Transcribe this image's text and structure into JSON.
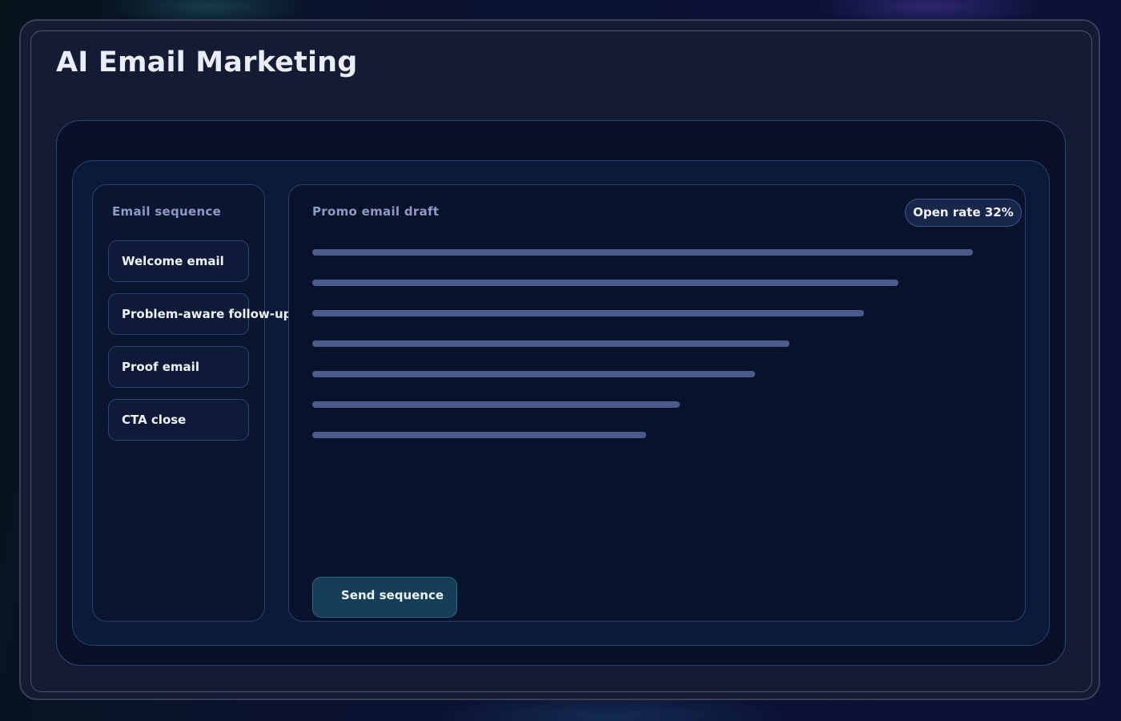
{
  "header": {
    "title": "AI Email Marketing"
  },
  "sidebar": {
    "heading": "Email sequence",
    "items": [
      {
        "label": "Welcome email"
      },
      {
        "label": "Problem-aware follow-up"
      },
      {
        "label": "Proof email"
      },
      {
        "label": "CTA close"
      }
    ]
  },
  "editor": {
    "heading": "Promo email draft",
    "badge": "Open rate 32%",
    "send_label": "Send sequence"
  },
  "colors": {
    "background": "#0b1136",
    "panel": "#08122b",
    "text_line": "#4b5c8c",
    "accent_button": "#163e56"
  }
}
